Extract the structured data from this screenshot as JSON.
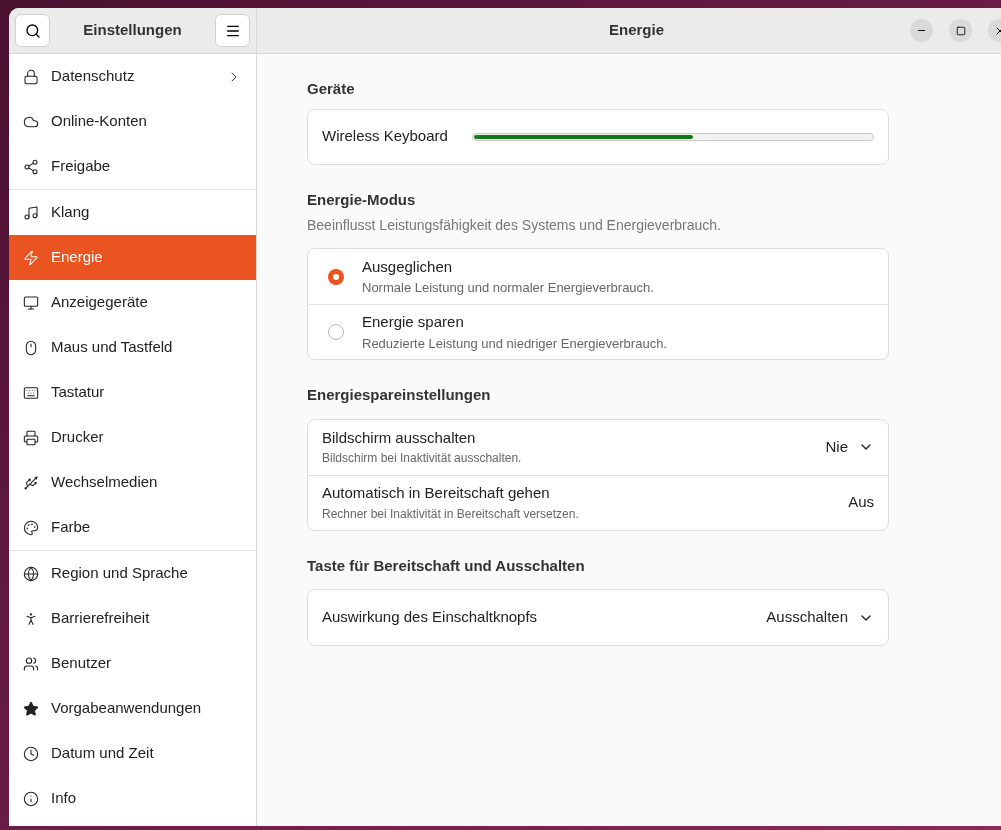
{
  "sidebar": {
    "title": "Einstellungen",
    "groups": [
      [
        {
          "label": "Datenschutz",
          "selected": false,
          "submenu": true
        },
        {
          "label": "Online-Konten",
          "selected": false,
          "submenu": false
        },
        {
          "label": "Freigabe",
          "selected": false,
          "submenu": false
        }
      ],
      [
        {
          "label": "Klang",
          "selected": false,
          "submenu": false
        },
        {
          "label": "Energie",
          "selected": true,
          "submenu": false
        },
        {
          "label": "Anzeigegeräte",
          "selected": false,
          "submenu": false
        },
        {
          "label": "Maus und Tastfeld",
          "selected": false,
          "submenu": false
        },
        {
          "label": "Tastatur",
          "selected": false,
          "submenu": false
        },
        {
          "label": "Drucker",
          "selected": false,
          "submenu": false
        },
        {
          "label": "Wechselmedien",
          "selected": false,
          "submenu": false
        },
        {
          "label": "Farbe",
          "selected": false,
          "submenu": false
        }
      ],
      [
        {
          "label": "Region und Sprache",
          "selected": false,
          "submenu": false
        },
        {
          "label": "Barrierefreiheit",
          "selected": false,
          "submenu": false
        },
        {
          "label": "Benutzer",
          "selected": false,
          "submenu": false
        },
        {
          "label": "Vorgabeanwendungen",
          "selected": false,
          "submenu": false
        },
        {
          "label": "Datum und Zeit",
          "selected": false,
          "submenu": false
        },
        {
          "label": "Info",
          "selected": false,
          "submenu": false
        }
      ]
    ]
  },
  "window": {
    "title": "Energie"
  },
  "devices": {
    "heading": "Geräte",
    "items": [
      {
        "name": "Wireless Keyboard",
        "level": 0.55
      }
    ]
  },
  "power_mode": {
    "heading": "Energie-Modus",
    "description": "Beeinflusst Leistungsfähigkeit des Systems und Energieverbrauch.",
    "options": [
      {
        "title": "Ausgeglichen",
        "subtitle": "Normale Leistung und normaler Energieverbrauch.",
        "selected": true
      },
      {
        "title": "Energie sparen",
        "subtitle": "Reduzierte Leistung und niedriger Energieverbrauch.",
        "selected": false
      }
    ]
  },
  "power_saving": {
    "heading": "Energiespareinstellungen",
    "rows": [
      {
        "title": "Bildschirm ausschalten",
        "subtitle": "Bildschirm bei Inaktivität ausschalten.",
        "value": "Nie",
        "kind": "dropdown"
      },
      {
        "title": "Automatisch in Bereitschaft gehen",
        "subtitle": "Rechner bei Inaktivität in Bereitschaft versetzen.",
        "value": "Aus",
        "kind": "link"
      }
    ]
  },
  "power_button": {
    "heading": "Taste für Bereitschaft und Ausschalten",
    "rows": [
      {
        "title": "Auswirkung des Einschaltknopfs",
        "value": "Ausschalten",
        "kind": "dropdown"
      }
    ]
  }
}
